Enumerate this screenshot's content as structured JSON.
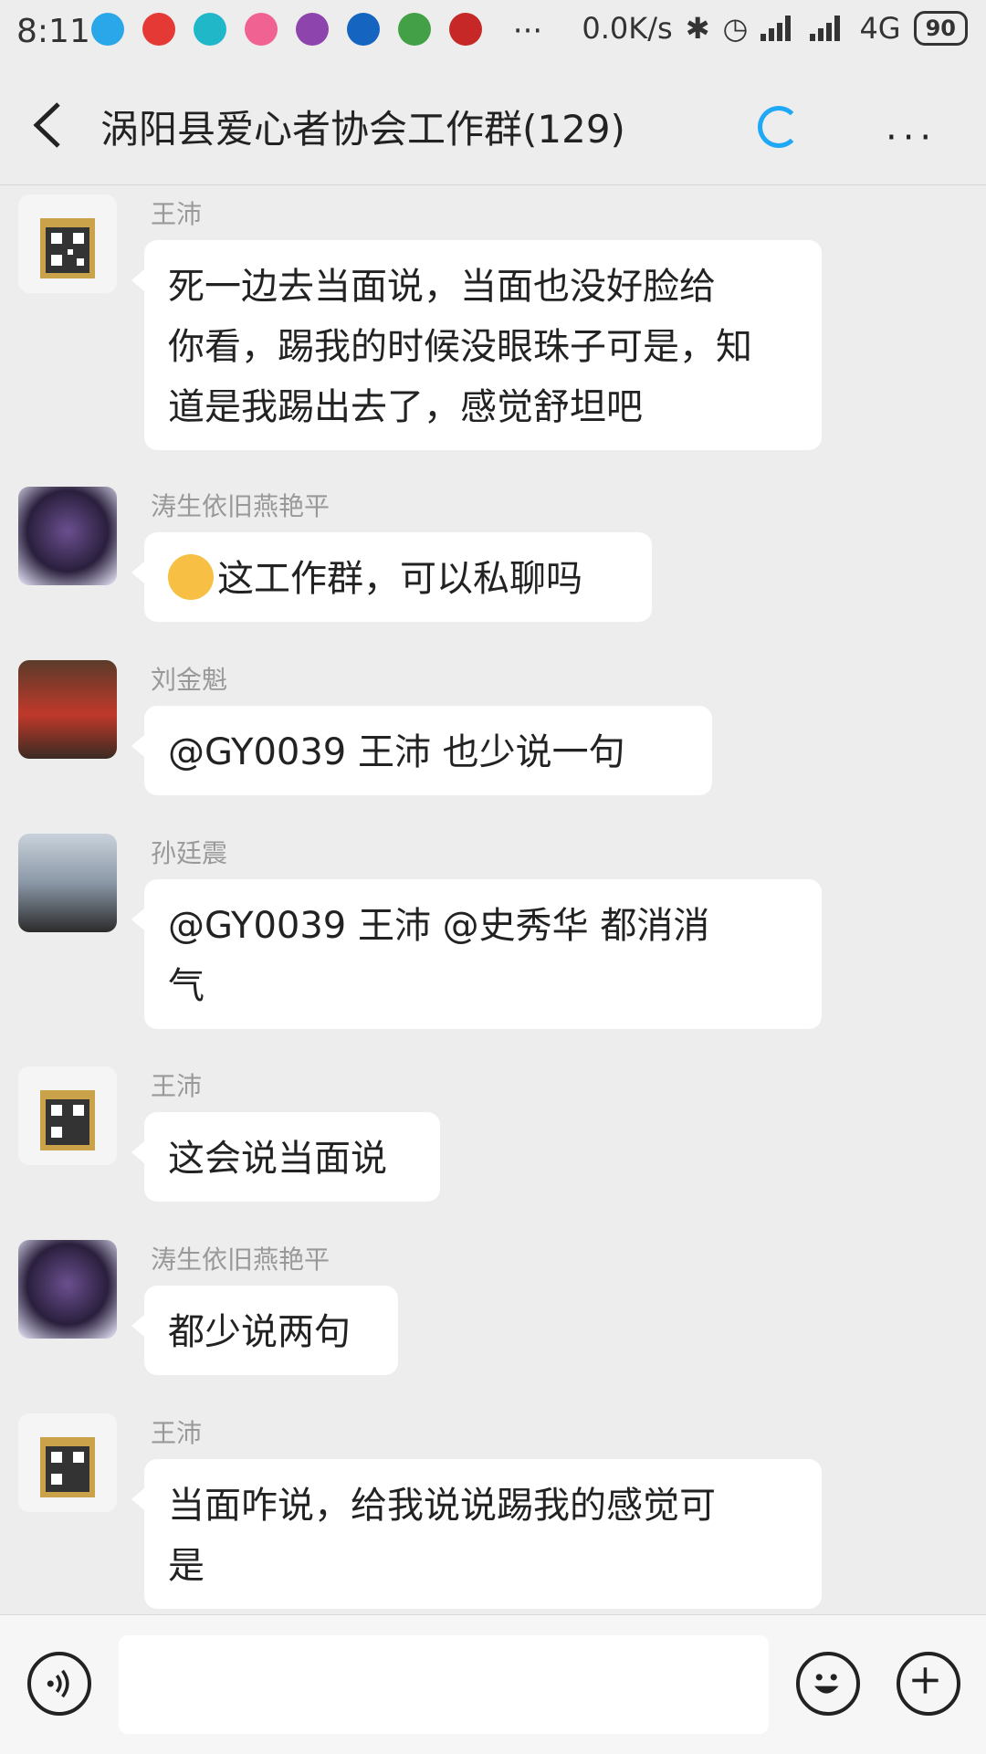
{
  "status_bar": {
    "time": "8:11",
    "network_speed": "0.0K/s",
    "network_type": "4G",
    "battery": "90",
    "notification_icon_colors": [
      "#2aa7e8",
      "#e53935",
      "#20b8c8",
      "#f06292",
      "#8e44ad",
      "#1565c0",
      "#43a047",
      "#c62828"
    ]
  },
  "header": {
    "title": "涡阳县爱心者协会工作群(129)",
    "accent_color": "#1fa8f5"
  },
  "messages": [
    {
      "sender": "王沛",
      "lines": [
        "死一边去当面说，当面也没好脸给",
        "你看，踢我的时候没眼珠子可是，知",
        "道是我踢出去了，感觉舒坦吧"
      ],
      "avatar_icon": "qr-avatar"
    },
    {
      "sender": "涛生依旧燕艳平",
      "lines": [
        "这工作群，可以私聊吗"
      ],
      "emoji": "dizzy-face-emoji",
      "avatar_icon": "portrait-avatar"
    },
    {
      "sender": "刘金魁",
      "lines": [
        "@GY0039 王沛   也少说一句"
      ],
      "avatar_icon": "photo-avatar"
    },
    {
      "sender": "孙廷震",
      "lines": [
        "@GY0039 王沛  @史秀华   都消消",
        "气"
      ],
      "avatar_icon": "photo-avatar"
    },
    {
      "sender": "王沛",
      "lines": [
        "这会说当面说"
      ],
      "avatar_icon": "qr-avatar"
    },
    {
      "sender": "涛生依旧燕艳平",
      "lines": [
        "都少说两句"
      ],
      "avatar_icon": "portrait-avatar"
    },
    {
      "sender": "王沛",
      "lines": [
        "当面咋说，给我说说踢我的感觉可",
        "是"
      ],
      "avatar_icon": "qr-avatar"
    }
  ],
  "composer": {
    "voice_icon": "voice-icon",
    "emoji_icon": "emoji-icon",
    "plus_icon": "plus-icon"
  }
}
